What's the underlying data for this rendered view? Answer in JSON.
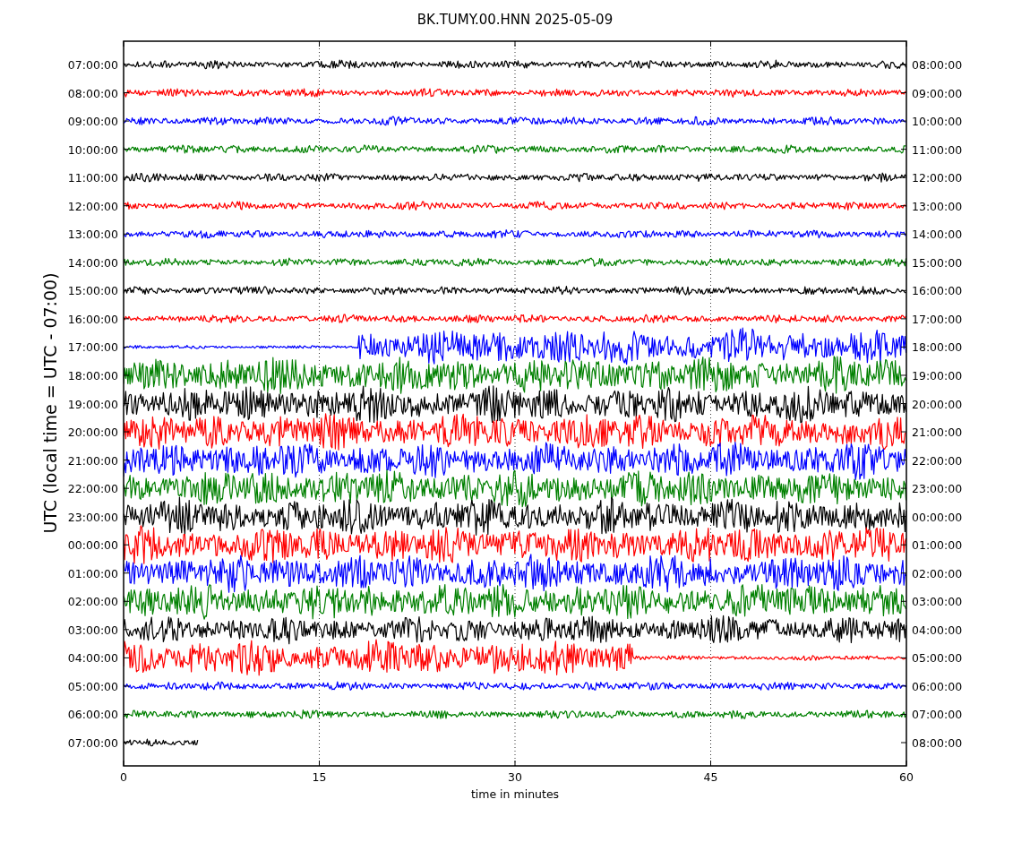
{
  "title": "BK.TUMY.00.HNN 2025-05-09",
  "y_axis_label": "UTC (local time = UTC - 07:00)",
  "x_axis_label": "time in minutes",
  "x_ticks": [
    "0",
    "15",
    "30",
    "45",
    "60"
  ],
  "left_labels": [
    "07:00:00",
    "08:00:00",
    "09:00:00",
    "10:00:00",
    "11:00:00",
    "12:00:00",
    "13:00:00",
    "14:00:00",
    "15:00:00",
    "16:00:00",
    "17:00:00",
    "18:00:00",
    "19:00:00",
    "20:00:00",
    "21:00:00",
    "22:00:00",
    "23:00:00",
    "00:00:00",
    "01:00:00",
    "02:00:00",
    "03:00:00",
    "04:00:00",
    "05:00:00",
    "06:00:00",
    "07:00:00"
  ],
  "right_labels": [
    "08:00:00",
    "09:00:00",
    "10:00:00",
    "11:00:00",
    "12:00:00",
    "13:00:00",
    "14:00:00",
    "15:00:00",
    "16:00:00",
    "17:00:00",
    "18:00:00",
    "19:00:00",
    "20:00:00",
    "21:00:00",
    "22:00:00",
    "23:00:00",
    "00:00:00",
    "01:00:00",
    "02:00:00",
    "03:00:00",
    "04:00:00",
    "05:00:00",
    "06:00:00",
    "07:00:00",
    "08:00:00"
  ],
  "traces": [
    {
      "color": "#000000"
    },
    {
      "color": "#ff0000"
    },
    {
      "color": "#0000ff"
    },
    {
      "color": "#008000"
    },
    {
      "color": "#000000"
    },
    {
      "color": "#ff0000"
    },
    {
      "color": "#0000ff"
    },
    {
      "color": "#008000"
    },
    {
      "color": "#000000"
    },
    {
      "color": "#ff0000"
    },
    {
      "color": "#0000ff"
    },
    {
      "color": "#008000"
    },
    {
      "color": "#000000"
    },
    {
      "color": "#ff0000"
    },
    {
      "color": "#0000ff"
    },
    {
      "color": "#008000"
    },
    {
      "color": "#000000"
    },
    {
      "color": "#ff0000"
    },
    {
      "color": "#0000ff"
    },
    {
      "color": "#008000"
    },
    {
      "color": "#000000"
    },
    {
      "color": "#ff0000"
    },
    {
      "color": "#0000ff"
    },
    {
      "color": "#008000"
    },
    {
      "color": "#000000"
    }
  ]
}
